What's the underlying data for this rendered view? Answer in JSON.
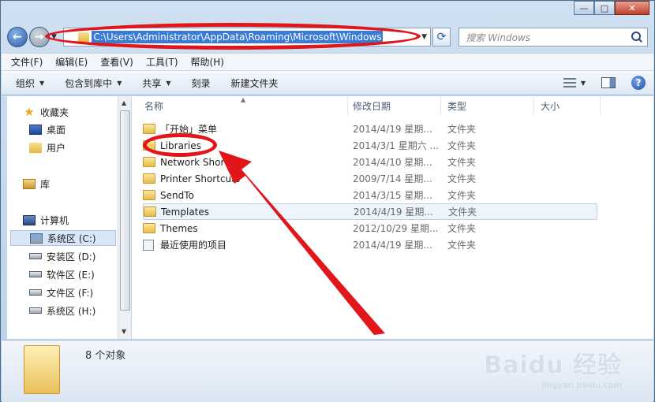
{
  "address": {
    "path": "C:\\Users\\Administrator\\AppData\\Roaming\\Microsoft\\Windows"
  },
  "search": {
    "placeholder": "搜索 Windows"
  },
  "menubar": [
    "文件(F)",
    "编辑(E)",
    "查看(V)",
    "工具(T)",
    "帮助(H)"
  ],
  "toolbar": {
    "organize": "组织",
    "include_library": "包含到库中",
    "share": "共享",
    "burn": "刻录",
    "new_folder": "新建文件夹"
  },
  "nav": {
    "favorites": "收藏夹",
    "desktop": "桌面",
    "user": "用户",
    "libraries": "库",
    "computer": "计算机",
    "drives": [
      "系统区 (C:)",
      "安装区 (D:)",
      "软件区 (E:)",
      "文件区 (F:)",
      "系统区 (H:)"
    ]
  },
  "columns": {
    "name": "名称",
    "date": "修改日期",
    "type": "类型",
    "size": "大小"
  },
  "files": [
    {
      "name": "「开始」菜单",
      "date": "2014/4/19 星期...",
      "type": "文件夹",
      "icon": "folder-icon"
    },
    {
      "name": "Libraries",
      "date": "2014/3/1 星期六 ...",
      "type": "文件夹",
      "icon": "folder-icon"
    },
    {
      "name": "Network Shortcuts",
      "date": "2014/4/10 星期...",
      "type": "文件夹",
      "icon": "folder-icon"
    },
    {
      "name": "Printer Shortcuts",
      "date": "2009/7/14 星期...",
      "type": "文件夹",
      "icon": "folder-icon"
    },
    {
      "name": "SendTo",
      "date": "2014/3/15 星期...",
      "type": "文件夹",
      "icon": "folder-icon"
    },
    {
      "name": "Templates",
      "date": "2014/4/19 星期...",
      "type": "文件夹",
      "icon": "folder-icon"
    },
    {
      "name": "Themes",
      "date": "2012/10/29 星期...",
      "type": "文件夹",
      "icon": "folder-icon"
    },
    {
      "name": "最近使用的项目",
      "date": "2014/4/19 星期...",
      "type": "文件夹",
      "icon": "recent-items-icon"
    }
  ],
  "status": {
    "count": "8 个对象"
  },
  "watermark": {
    "logo": "Baidu 经验",
    "url": "jingyan.baidu.com"
  },
  "colors": {
    "annotation": "#e0161a",
    "selection": "#3a7bd5"
  }
}
